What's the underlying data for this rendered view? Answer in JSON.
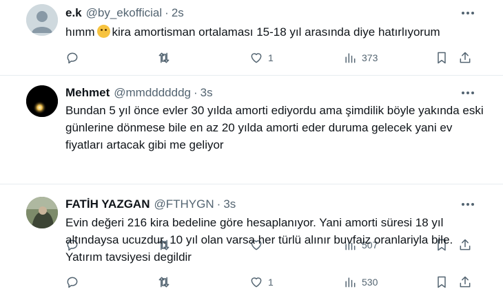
{
  "tweets": [
    {
      "name": "e.k",
      "handle": "@by_ekofficial",
      "time": "2s",
      "text_before": "hımm",
      "text_after": "kira amortisman ortalaması 15-18 yıl arasında diye hatırlıyorum",
      "emoji_icon": "face-with-monocle-emoji",
      "likes": "1",
      "views": "373"
    },
    {
      "name": "Mehmet",
      "handle": "@mmddddddg",
      "time": "3s",
      "text": "Bundan 5 yıl önce evler 30 yılda amorti ediyordu ama şimdilik böyle yakında eski günlerine dönmese bile en az 20 yılda amorti eder duruma gelecek yani ev fiyatları artacak gibi me geliyor",
      "likes": "",
      "views": "507"
    },
    {
      "name": "FATİH YAZGAN",
      "handle": "@FTHYGN",
      "time": "3s",
      "text": "Evin değeri 216 kira bedeline göre hesaplanıyor. Yani amorti süresi 18 yıl altındaysa ucuzdur. 10 yıl olan varsa her türlü alınır buvfaiz oranlariyla bile. Yatırım tavsiyesi degildir",
      "likes": "1",
      "views": "530"
    }
  ],
  "separator": "·",
  "colors": {
    "text": "#0f1419",
    "secondary": "#536471",
    "divider": "#e6ecf0"
  }
}
